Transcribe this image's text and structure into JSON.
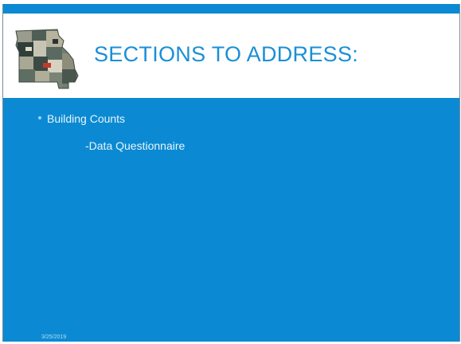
{
  "slide": {
    "title": "SECTIONS TO ADDRESS:",
    "bullets": [
      {
        "text": "Building Counts",
        "subitems": [
          "-Data Questionnaire"
        ]
      }
    ],
    "footer_date": "3/25/2019",
    "logo": "missouri-state-map-logo"
  },
  "colors": {
    "background": "#0b8ad3",
    "title": "#1a8fd6",
    "header_band": "#ffffff",
    "body_text": "#e8f4fb"
  }
}
